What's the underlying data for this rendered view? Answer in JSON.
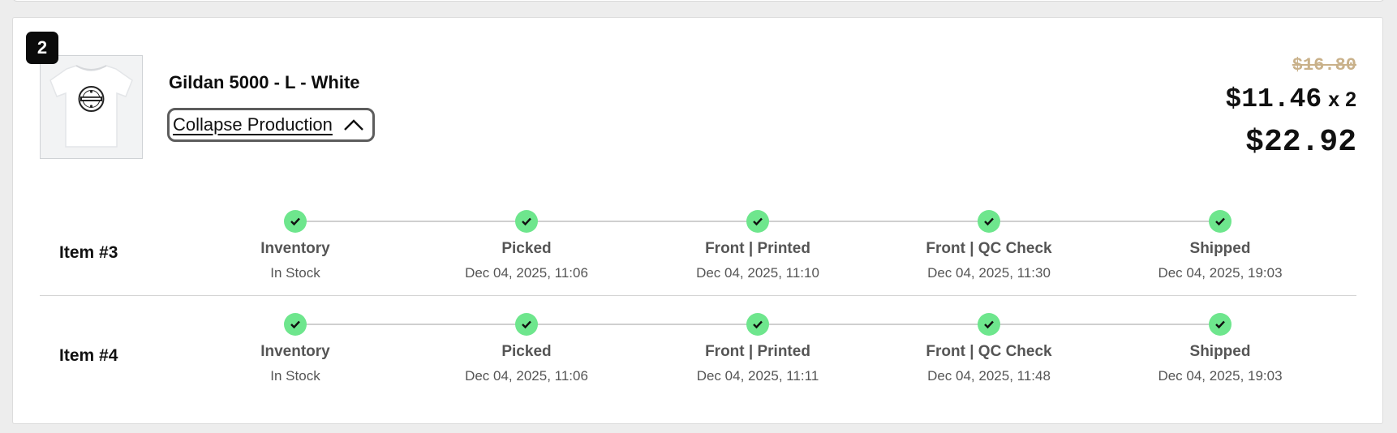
{
  "item": {
    "index": "2",
    "title": "Gildan 5000 - L - White",
    "collapse_label": "Collapse Production",
    "price_original": "$16.80",
    "price_unit": "$11.46",
    "quantity": "x 2",
    "price_total": "$22.92",
    "thumbnail_icon": "tshirt-image"
  },
  "colors": {
    "step_complete": "#6ee68d",
    "strike_price": "#c9b18a"
  },
  "tracking": [
    {
      "label": "Item #3",
      "steps": [
        {
          "name": "Inventory",
          "detail": "In Stock",
          "status": "complete"
        },
        {
          "name": "Picked",
          "detail": "Dec 04, 2025, 11:06",
          "status": "complete"
        },
        {
          "name": "Front | Printed",
          "detail": "Dec 04, 2025, 11:10",
          "status": "complete"
        },
        {
          "name": "Front | QC Check",
          "detail": "Dec 04, 2025, 11:30",
          "status": "complete"
        },
        {
          "name": "Shipped",
          "detail": "Dec 04, 2025, 19:03",
          "status": "complete"
        }
      ]
    },
    {
      "label": "Item #4",
      "steps": [
        {
          "name": "Inventory",
          "detail": "In Stock",
          "status": "complete"
        },
        {
          "name": "Picked",
          "detail": "Dec 04, 2025, 11:06",
          "status": "complete"
        },
        {
          "name": "Front | Printed",
          "detail": "Dec 04, 2025, 11:11",
          "status": "complete"
        },
        {
          "name": "Front | QC Check",
          "detail": "Dec 04, 2025, 11:48",
          "status": "complete"
        },
        {
          "name": "Shipped",
          "detail": "Dec 04, 2025, 19:03",
          "status": "complete"
        }
      ]
    }
  ]
}
